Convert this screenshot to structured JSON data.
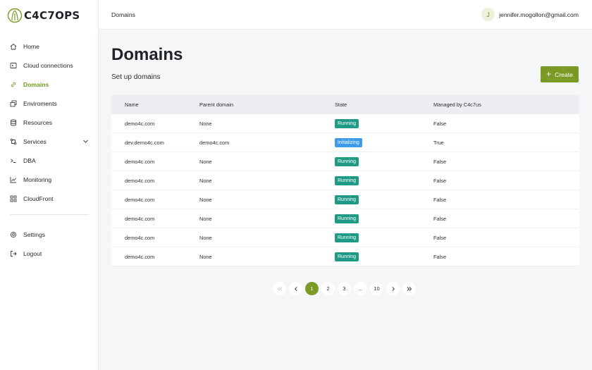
{
  "app": {
    "brand": "C4C7OPS",
    "accent": "#7a9a25"
  },
  "sidebar": {
    "items": [
      {
        "label": "Home",
        "icon": "home-icon",
        "active": false
      },
      {
        "label": "Cloud connections",
        "icon": "cloud-connections-icon",
        "active": false
      },
      {
        "label": "Domains",
        "icon": "link-icon",
        "active": true
      },
      {
        "label": "Enviroments",
        "icon": "environments-icon",
        "active": false
      },
      {
        "label": "Resources",
        "icon": "database-icon",
        "active": false
      },
      {
        "label": "Services",
        "icon": "services-icon",
        "active": false,
        "expandable": true
      },
      {
        "label": "DBA",
        "icon": "terminal-icon",
        "active": false
      },
      {
        "label": "Monitoring",
        "icon": "chart-icon",
        "active": false
      },
      {
        "label": "CloudFront",
        "icon": "cloudfront-icon",
        "active": false
      }
    ],
    "bottom": [
      {
        "label": "Settings",
        "icon": "gear-icon"
      },
      {
        "label": "Logout",
        "icon": "logout-icon"
      }
    ]
  },
  "topbar": {
    "breadcrumb": "Domains",
    "user": {
      "initial": "J",
      "email": "jennifer.mogollon@gmail.com"
    }
  },
  "main": {
    "title": "Domains",
    "subtitle": "Set up domains",
    "create_label": "Create"
  },
  "table": {
    "columns": [
      "Name",
      "Parent domain",
      "State",
      "Managed by C4c7us"
    ],
    "rows": [
      {
        "name": "demo4c.com",
        "parent": "None",
        "state": "Running",
        "managed": "False"
      },
      {
        "name": "dev.demo4c.com",
        "parent": "demo4c.com",
        "state": "Initializing",
        "managed": "True"
      },
      {
        "name": "demo4c.com",
        "parent": "None",
        "state": "Running",
        "managed": "False"
      },
      {
        "name": "demo4c.com",
        "parent": "None",
        "state": "Running",
        "managed": "False"
      },
      {
        "name": "demo4c.com",
        "parent": "None",
        "state": "Running",
        "managed": "False"
      },
      {
        "name": "demo4c.com",
        "parent": "None",
        "state": "Running",
        "managed": "False"
      },
      {
        "name": "demo4c.com",
        "parent": "None",
        "state": "Running",
        "managed": "False"
      },
      {
        "name": "demo4c.com",
        "parent": "None",
        "state": "Running",
        "managed": "False"
      }
    ],
    "state_colors": {
      "Running": "#1f9a86",
      "Initializing": "#3d9be9"
    }
  },
  "pagination": {
    "pages": [
      "1",
      "2",
      "3",
      "...",
      "10"
    ],
    "current": "1"
  }
}
